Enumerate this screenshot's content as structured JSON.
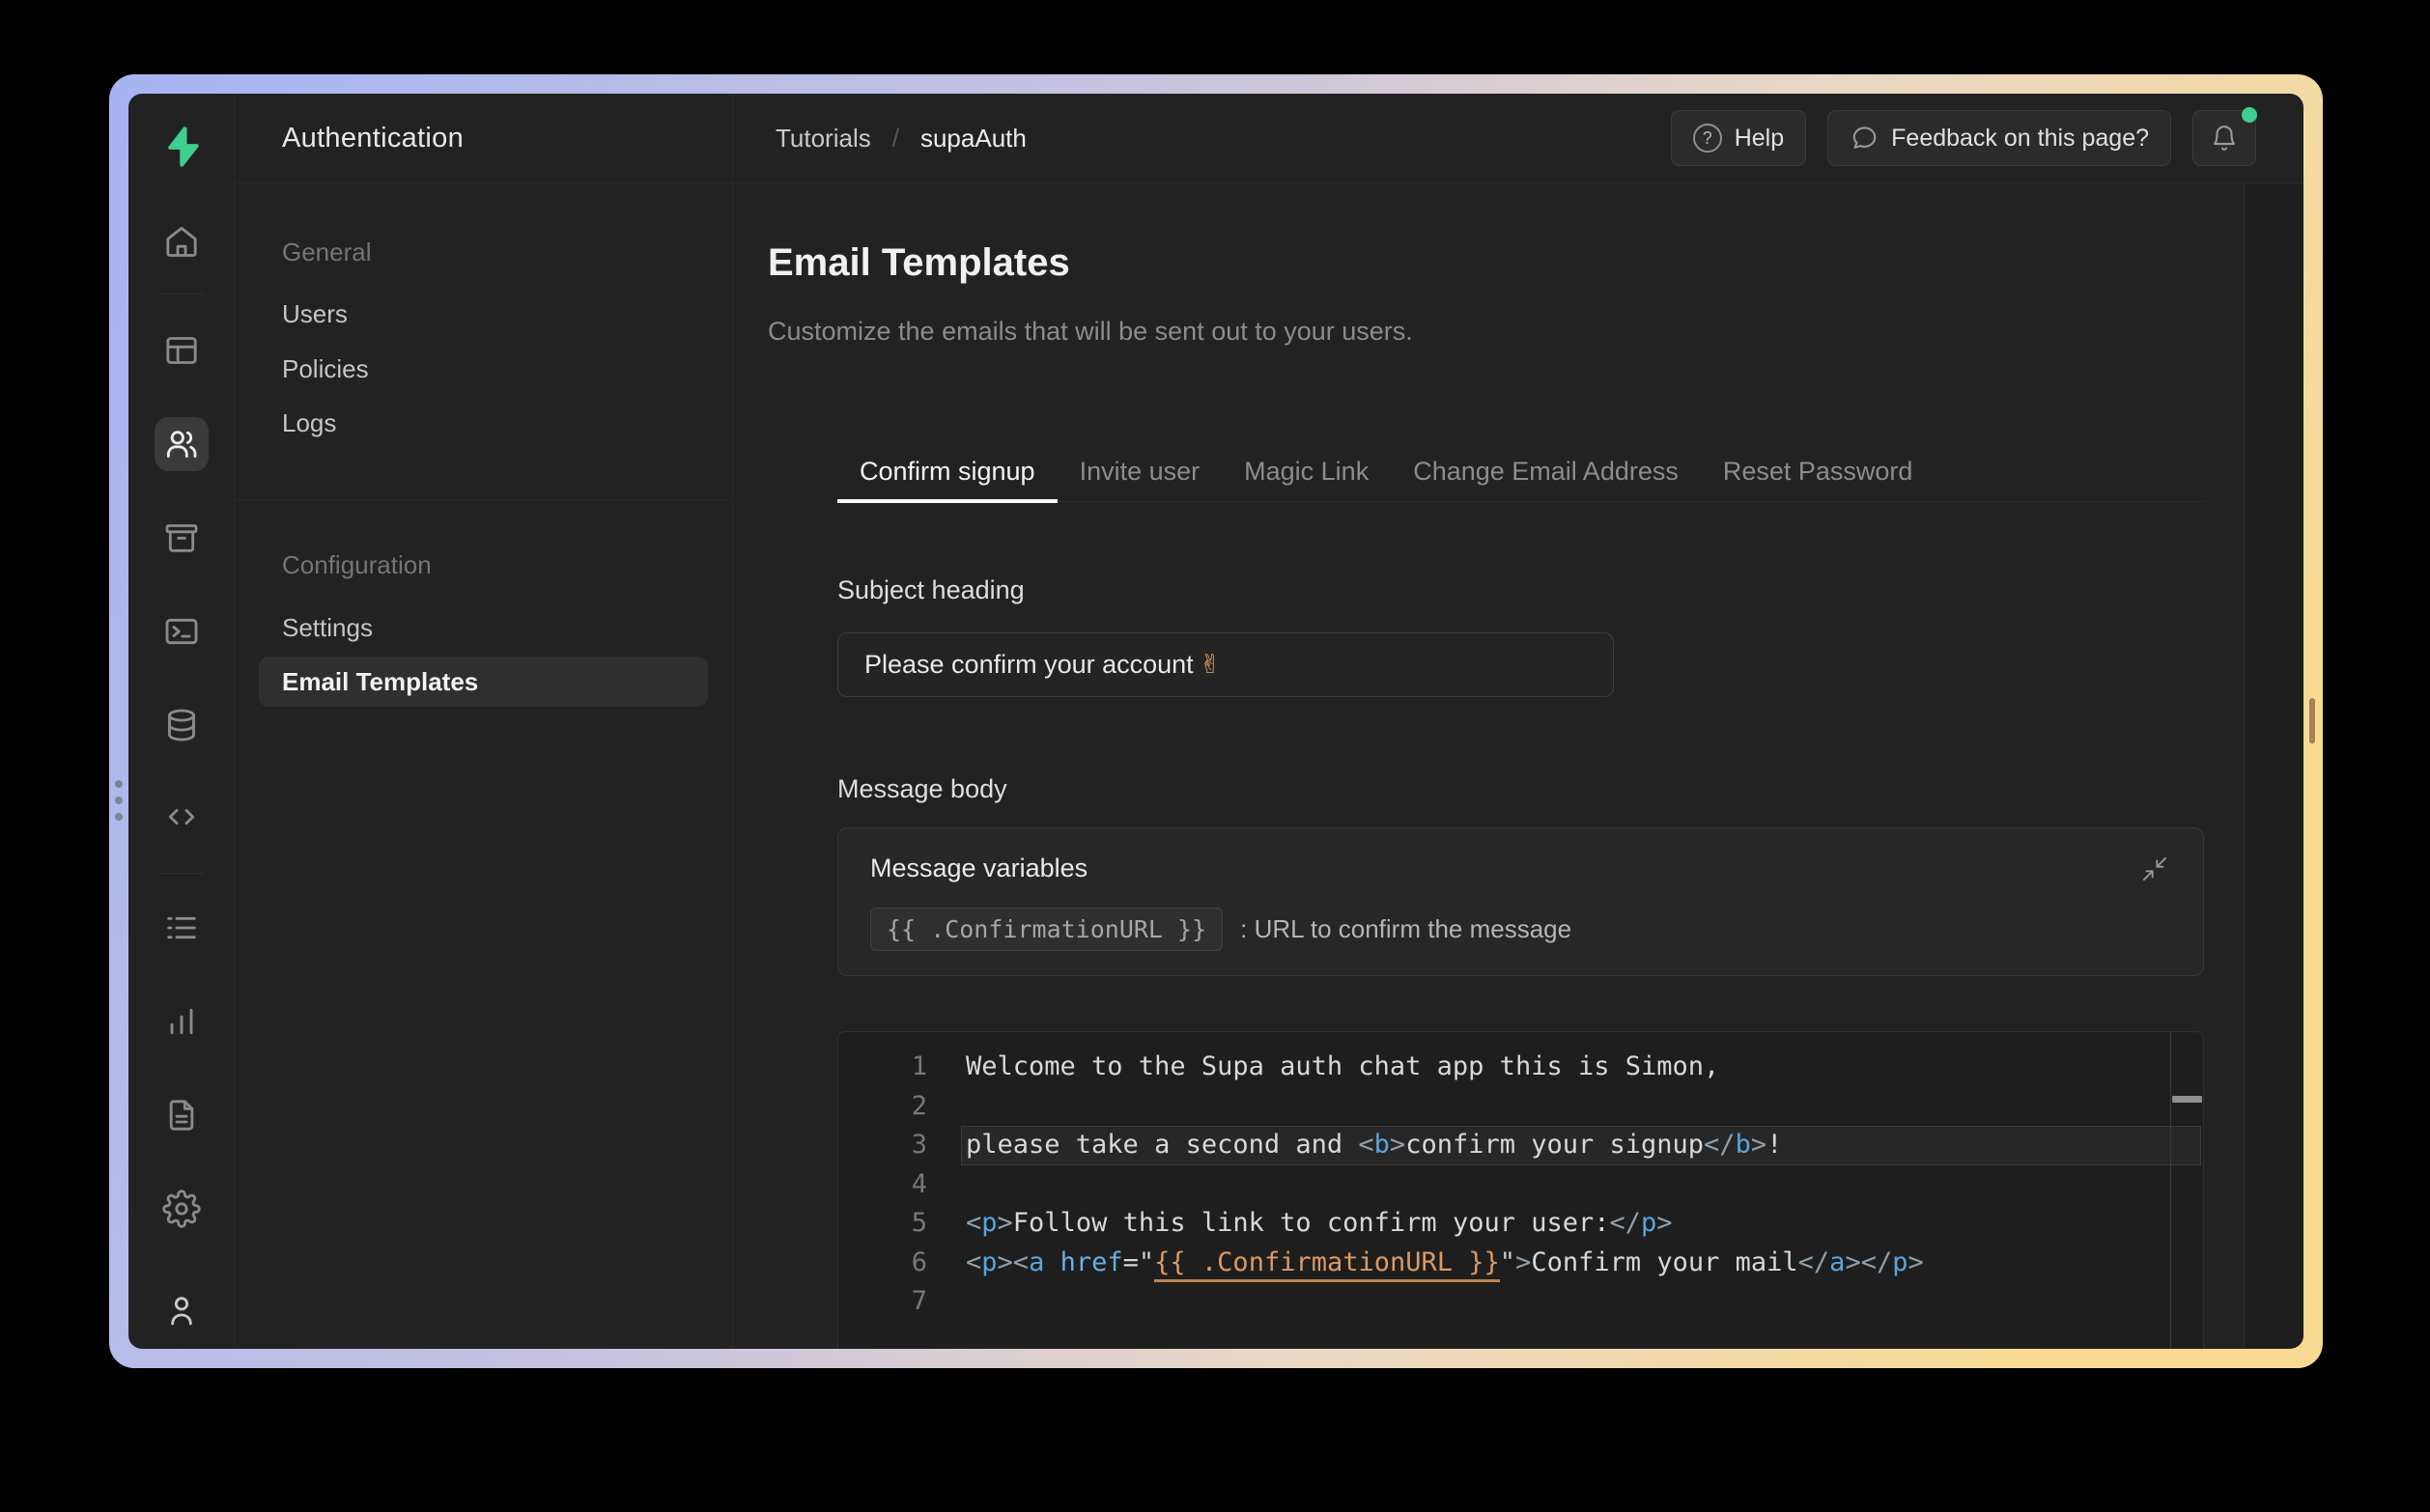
{
  "colors": {
    "accent_green": "#3ecf8e",
    "border_gradient_left": "#a5b4f2",
    "border_gradient_right": "#f8da92",
    "code_tag_blue": "#58a6dc",
    "code_string_orange": "#dc9a63"
  },
  "rail": {
    "items": [
      {
        "icon": "home"
      },
      {
        "icon": "table-editor"
      },
      {
        "icon": "authentication-users",
        "active": true
      },
      {
        "icon": "storage"
      },
      {
        "icon": "sql-terminal"
      },
      {
        "icon": "database"
      },
      {
        "icon": "api-code"
      },
      {
        "icon": "logs-list"
      },
      {
        "icon": "reports-chart"
      },
      {
        "icon": "docs-file"
      },
      {
        "icon": "settings-gear"
      },
      {
        "icon": "account-user"
      }
    ]
  },
  "sidebar": {
    "title": "Authentication",
    "sections": [
      {
        "header": "General",
        "items": [
          {
            "label": "Users"
          },
          {
            "label": "Policies"
          },
          {
            "label": "Logs"
          }
        ]
      },
      {
        "header": "Configuration",
        "items": [
          {
            "label": "Settings"
          },
          {
            "label": "Email Templates",
            "active": true
          }
        ]
      }
    ]
  },
  "header": {
    "breadcrumb": [
      {
        "label": "Tutorials"
      },
      {
        "label": "supaAuth"
      }
    ],
    "separator": "/",
    "help_label": "Help",
    "help_icon_char": "?",
    "feedback_label": "Feedback on this page?"
  },
  "page": {
    "title": "Email Templates",
    "subtitle": "Customize the emails that will be sent out to your users.",
    "tabs": [
      {
        "label": "Confirm signup",
        "active": true
      },
      {
        "label": "Invite user"
      },
      {
        "label": "Magic Link"
      },
      {
        "label": "Change Email Address"
      },
      {
        "label": "Reset Password"
      }
    ],
    "subject": {
      "label": "Subject heading",
      "value": "Please confirm your account",
      "emoji": "✌"
    },
    "message_body_label": "Message body",
    "variables": {
      "title": "Message variables",
      "chip": "{{ .ConfirmationURL }}",
      "description": ": URL to confirm the message"
    },
    "editor": {
      "lines": [
        {
          "num": 1,
          "tokens": [
            {
              "c": "pln",
              "t": "Welcome to the Supa auth chat app this is Simon,"
            }
          ]
        },
        {
          "num": 2,
          "tokens": []
        },
        {
          "num": 3,
          "active": true,
          "tokens": [
            {
              "c": "pln",
              "t": "please take a second and "
            },
            {
              "c": "pun",
              "t": "<"
            },
            {
              "c": "tag",
              "t": "b"
            },
            {
              "c": "pun",
              "t": ">"
            },
            {
              "c": "pln",
              "t": "confirm your signup"
            },
            {
              "c": "pun",
              "t": "</"
            },
            {
              "c": "tag",
              "t": "b"
            },
            {
              "c": "pun",
              "t": ">"
            },
            {
              "c": "pln",
              "t": "!"
            }
          ]
        },
        {
          "num": 4,
          "tokens": []
        },
        {
          "num": 5,
          "tokens": [
            {
              "c": "pun",
              "t": "<"
            },
            {
              "c": "tag",
              "t": "p"
            },
            {
              "c": "pun",
              "t": ">"
            },
            {
              "c": "pln",
              "t": "Follow this link to confirm your user:"
            },
            {
              "c": "pun",
              "t": "</"
            },
            {
              "c": "tag",
              "t": "p"
            },
            {
              "c": "pun",
              "t": ">"
            }
          ]
        },
        {
          "num": 6,
          "tokens": [
            {
              "c": "pun",
              "t": "<"
            },
            {
              "c": "tag",
              "t": "p"
            },
            {
              "c": "pun",
              "t": ">"
            },
            {
              "c": "pun",
              "t": "<"
            },
            {
              "c": "tag",
              "t": "a"
            },
            {
              "c": "pln",
              "t": " "
            },
            {
              "c": "attr",
              "t": "href"
            },
            {
              "c": "pln",
              "t": "="
            },
            {
              "c": "q",
              "t": "\""
            },
            {
              "c": "str",
              "t": "{{ .ConfirmationURL }}"
            },
            {
              "c": "q",
              "t": "\""
            },
            {
              "c": "pun",
              "t": ">"
            },
            {
              "c": "pln",
              "t": "Confirm your mail"
            },
            {
              "c": "pun",
              "t": "</"
            },
            {
              "c": "tag",
              "t": "a"
            },
            {
              "c": "pun",
              "t": ">"
            },
            {
              "c": "pun",
              "t": "</"
            },
            {
              "c": "tag",
              "t": "p"
            },
            {
              "c": "pun",
              "t": ">"
            }
          ]
        },
        {
          "num": 7,
          "tokens": []
        }
      ]
    }
  }
}
